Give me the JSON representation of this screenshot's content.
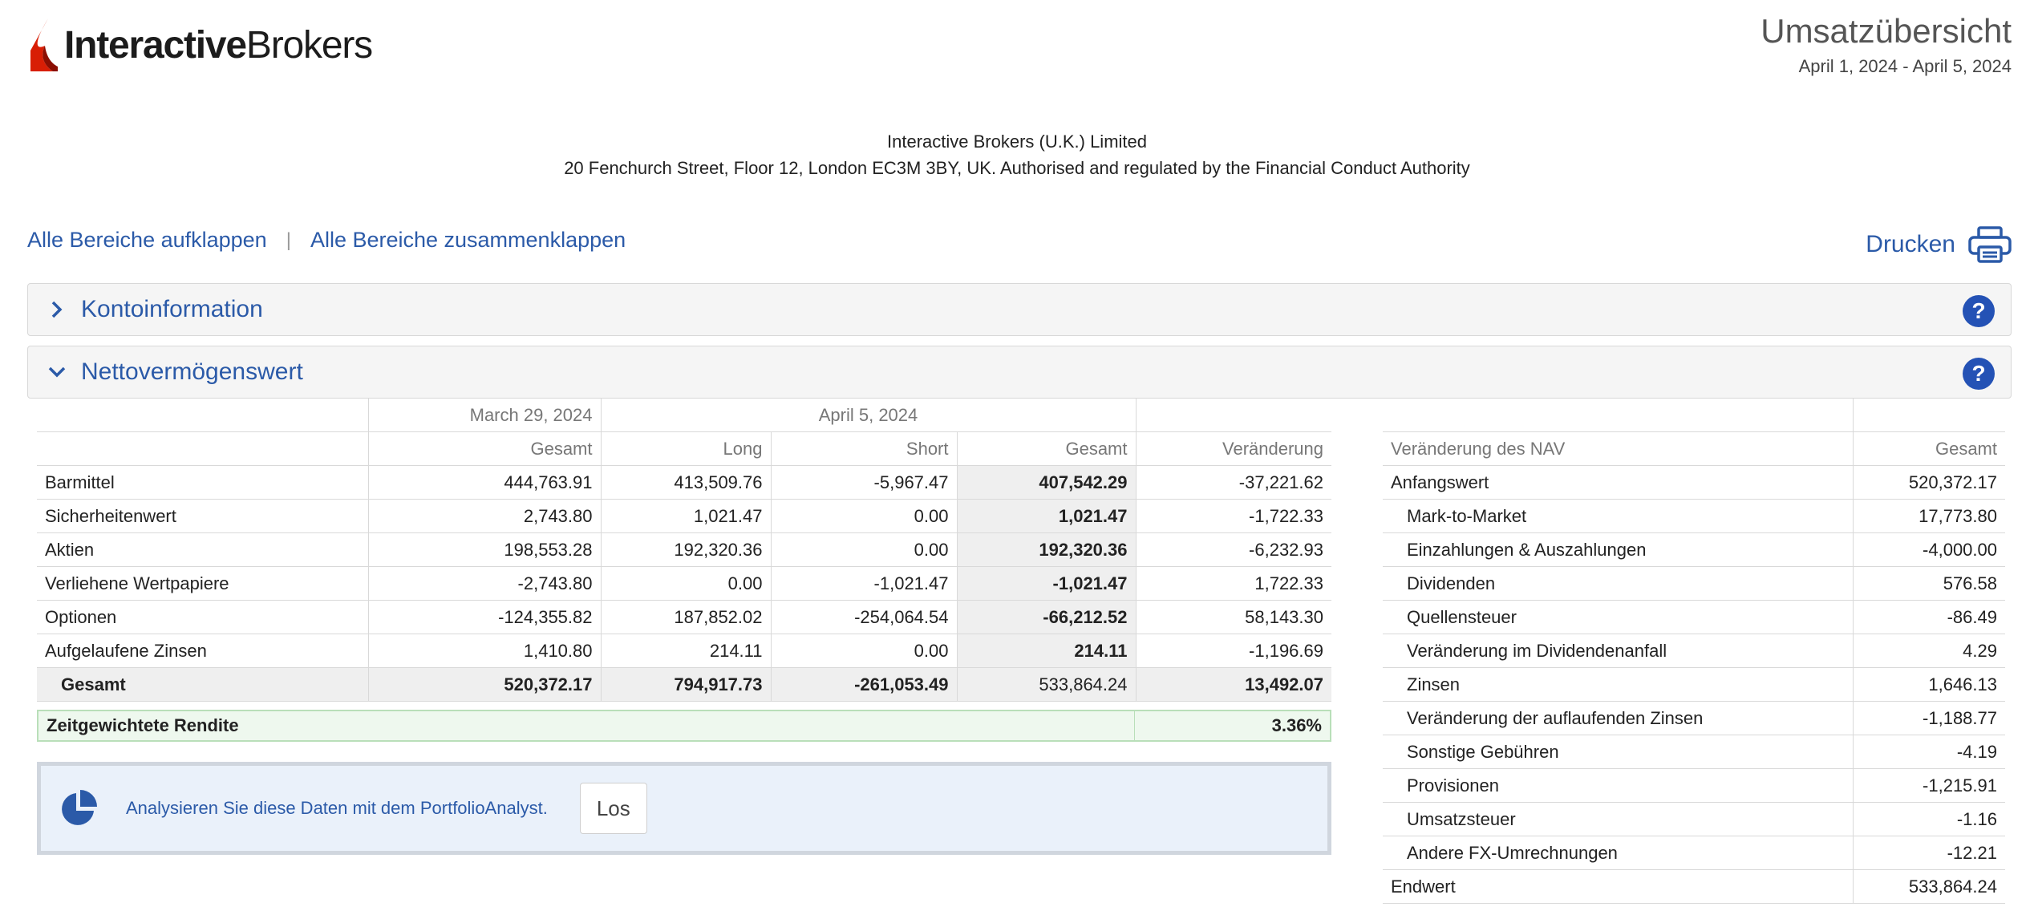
{
  "header": {
    "logo_bold": "Interactive",
    "logo_light": "Brokers",
    "title": "Umsatzübersicht",
    "date_range": "April 1, 2024 - April 5, 2024"
  },
  "address": {
    "line1": "Interactive Brokers (U.K.) Limited",
    "line2": "20 Fenchurch Street, Floor 12, London EC3M 3BY, UK. Authorised and regulated by the Financial Conduct Authority"
  },
  "controls": {
    "expand_all": "Alle Bereiche aufklappen",
    "separator": "|",
    "collapse_all": "Alle Bereiche zusammenklappen",
    "print": "Drucken"
  },
  "sections": {
    "account_info": "Kontoinformation",
    "nav": "Nettovermögenswert",
    "help_glyph": "?"
  },
  "nav_table": {
    "prev_date": "March 29, 2024",
    "curr_date": "April 5, 2024",
    "columns": {
      "prev_total": "Gesamt",
      "long": "Long",
      "short": "Short",
      "total": "Gesamt",
      "change": "Veränderung"
    },
    "rows": [
      {
        "label": "Barmittel",
        "prev": "444,763.91",
        "long": "413,509.76",
        "short": "-5,967.47",
        "total": "407,542.29",
        "change": "-37,221.62"
      },
      {
        "label": "Sicherheitenwert",
        "prev": "2,743.80",
        "long": "1,021.47",
        "short": "0.00",
        "total": "1,021.47",
        "change": "-1,722.33"
      },
      {
        "label": "Aktien",
        "prev": "198,553.28",
        "long": "192,320.36",
        "short": "0.00",
        "total": "192,320.36",
        "change": "-6,232.93"
      },
      {
        "label": "Verliehene Wertpapiere",
        "prev": "-2,743.80",
        "long": "0.00",
        "short": "-1,021.47",
        "total": "-1,021.47",
        "change": "1,722.33"
      },
      {
        "label": "Optionen",
        "prev": "-124,355.82",
        "long": "187,852.02",
        "short": "-254,064.54",
        "total": "-66,212.52",
        "change": "58,143.30"
      },
      {
        "label": "Aufgelaufene Zinsen",
        "prev": "1,410.80",
        "long": "214.11",
        "short": "0.00",
        "total": "214.11",
        "change": "-1,196.69"
      }
    ],
    "total": {
      "label": "Gesamt",
      "prev": "520,372.17",
      "long": "794,917.73",
      "short": "-261,053.49",
      "total": "533,864.24",
      "change": "13,492.07"
    }
  },
  "twr": {
    "label": "Zeitgewichtete Rendite",
    "value": "3.36%"
  },
  "portfolio_analyst": {
    "text": "Analysieren Sie diese Daten mit dem PortfolioAnalyst.",
    "button": "Los"
  },
  "nav_change": {
    "header_label": "Veränderung des NAV",
    "header_total": "Gesamt",
    "rows": [
      {
        "label": "Anfangswert",
        "value": "520,372.17",
        "sub": false
      },
      {
        "label": "Mark-to-Market",
        "value": "17,773.80",
        "sub": true
      },
      {
        "label": "Einzahlungen & Auszahlungen",
        "value": "-4,000.00",
        "sub": true
      },
      {
        "label": "Dividenden",
        "value": "576.58",
        "sub": true
      },
      {
        "label": "Quellensteuer",
        "value": "-86.49",
        "sub": true
      },
      {
        "label": "Veränderung im Dividendenanfall",
        "value": "4.29",
        "sub": true
      },
      {
        "label": "Zinsen",
        "value": "1,646.13",
        "sub": true
      },
      {
        "label": "Veränderung der auflaufenden Zinsen",
        "value": "-1,188.77",
        "sub": true
      },
      {
        "label": "Sonstige Gebühren",
        "value": "-4.19",
        "sub": true
      },
      {
        "label": "Provisionen",
        "value": "-1,215.91",
        "sub": true
      },
      {
        "label": "Umsatzsteuer",
        "value": "-1.16",
        "sub": true
      },
      {
        "label": "Andere FX-Umrechnungen",
        "value": "-12.21",
        "sub": true
      },
      {
        "label": "Endwert",
        "value": "533,864.24",
        "sub": false
      }
    ]
  },
  "colors": {
    "link_blue": "#2b5aa8",
    "help_blue": "#2452b5",
    "logo_red": "#d81e05"
  },
  "icons": {
    "logo": "ib-logo-icon",
    "print": "printer-icon",
    "help": "help-icon",
    "collapsed": "chevron-right-icon",
    "expanded": "chevron-down-icon",
    "analyst": "pie-chart-icon"
  }
}
